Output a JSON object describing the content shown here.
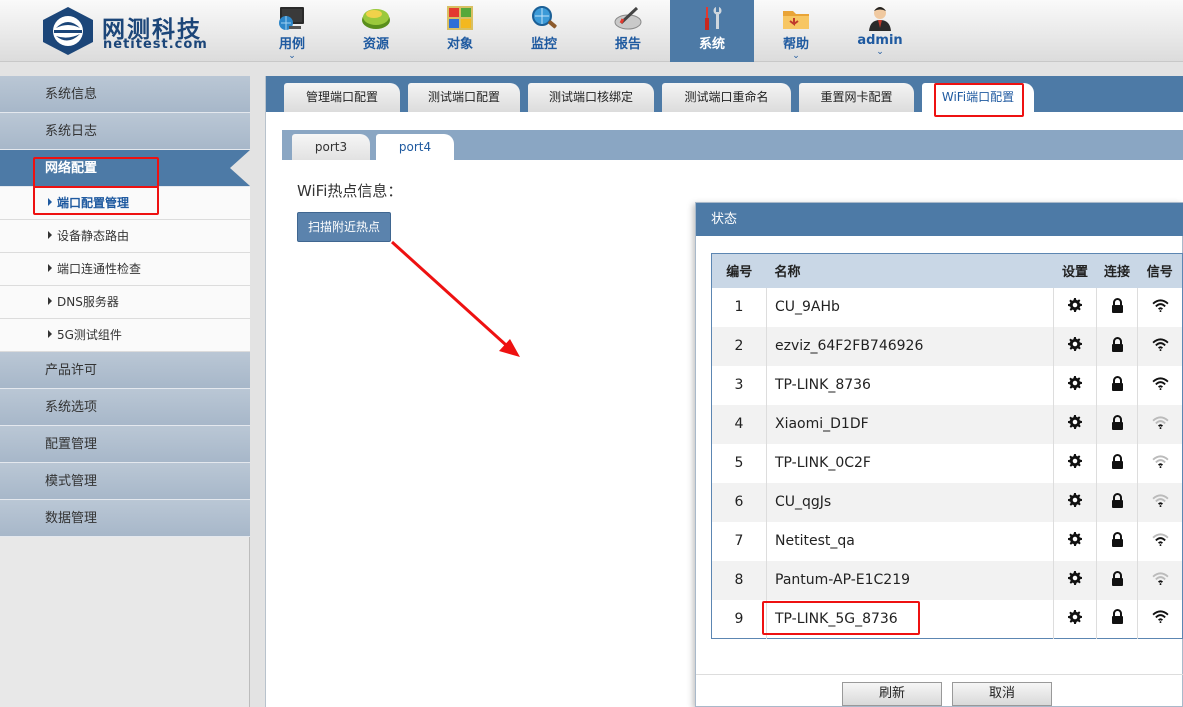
{
  "header": {
    "brand_name": "网测科技",
    "brand_domain": "netitest.com",
    "nav": [
      {
        "label": "用例",
        "icon": "monitor-globe-icon",
        "has_dropdown": true,
        "active": false
      },
      {
        "label": "资源",
        "icon": "resources-oval-icon",
        "has_dropdown": false,
        "active": false
      },
      {
        "label": "对象",
        "icon": "windows-logo-icon",
        "has_dropdown": false,
        "active": false
      },
      {
        "label": "监控",
        "icon": "magnifier-globe-icon",
        "has_dropdown": false,
        "active": false
      },
      {
        "label": "报告",
        "icon": "report-pen-icon",
        "has_dropdown": false,
        "active": false
      },
      {
        "label": "系统",
        "icon": "tools-icon",
        "has_dropdown": false,
        "active": true
      },
      {
        "label": "帮助",
        "icon": "help-folder-icon",
        "has_dropdown": true,
        "active": false
      },
      {
        "label": "admin",
        "icon": "user-avatar-icon",
        "has_dropdown": true,
        "active": false
      }
    ]
  },
  "sidebar": {
    "items": [
      {
        "label": "系统信息"
      },
      {
        "label": "系统日志"
      },
      {
        "label": "网络配置",
        "active": true
      },
      {
        "label": "端口配置管理",
        "sub": true,
        "active": true
      },
      {
        "label": "设备静态路由",
        "sub": true
      },
      {
        "label": "端口连通性检查",
        "sub": true
      },
      {
        "label": "DNS服务器",
        "sub": true
      },
      {
        "label": "5G测试组件",
        "sub": true
      },
      {
        "label": "产品许可"
      },
      {
        "label": "系统选项"
      },
      {
        "label": "配置管理"
      },
      {
        "label": "模式管理"
      },
      {
        "label": "数据管理"
      }
    ]
  },
  "main": {
    "tabs": [
      "管理端口配置",
      "测试端口配置",
      "测试端口核绑定",
      "测试端口重命名",
      "重置网卡配置",
      "WiFi端口配置"
    ],
    "active_tab": "WiFi端口配置",
    "subtabs": [
      "port3",
      "port4"
    ],
    "active_subtab": "port4",
    "wifi_title": "WiFi热点信息：",
    "scan_button": "扫描附近热点"
  },
  "dialog": {
    "title": "状态",
    "columns": [
      "编号",
      "名称",
      "设置",
      "连接",
      "信号"
    ],
    "rows": [
      {
        "num": "1",
        "name": "CU_9AHb",
        "signal": "strong"
      },
      {
        "num": "2",
        "name": "ezviz_64F2FB746926",
        "signal": "strong"
      },
      {
        "num": "3",
        "name": "TP-LINK_8736",
        "signal": "strong"
      },
      {
        "num": "4",
        "name": "Xiaomi_D1DF",
        "signal": "weak"
      },
      {
        "num": "5",
        "name": "TP-LINK_0C2F",
        "signal": "weak"
      },
      {
        "num": "6",
        "name": "CU_qgJs",
        "signal": "weak"
      },
      {
        "num": "7",
        "name": "Netitest_qa",
        "signal": "medium"
      },
      {
        "num": "8",
        "name": "Pantum-AP-E1C219",
        "signal": "weak"
      },
      {
        "num": "9",
        "name": "TP-LINK_5G_8736",
        "signal": "strong"
      }
    ],
    "refresh_button": "刷新",
    "cancel_button": "取消"
  },
  "colors": {
    "accent": "#4d7aa6",
    "annotation": "#ee1111",
    "brand": "#1c4679"
  }
}
